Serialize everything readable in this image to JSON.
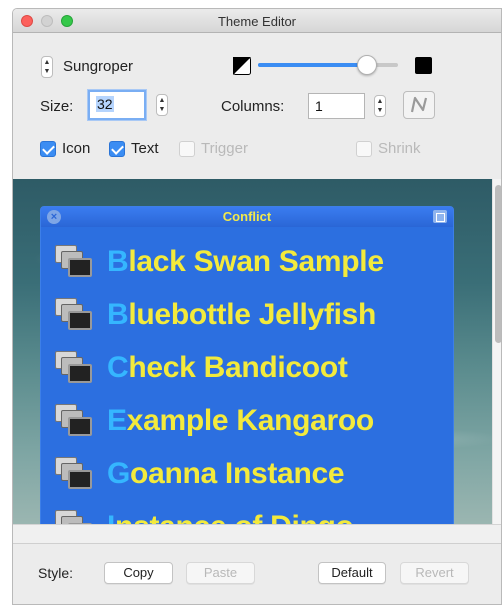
{
  "window": {
    "title": "Theme Editor"
  },
  "controls": {
    "theme_name": "Sungroper",
    "size_label": "Size:",
    "size_value": "32",
    "columns_label": "Columns:",
    "columns_value": "1",
    "opacity_level": 0.78,
    "checkboxes": [
      {
        "label": "Icon",
        "checked": true,
        "enabled": true
      },
      {
        "label": "Text",
        "checked": true,
        "enabled": true
      },
      {
        "label": "Trigger",
        "checked": false,
        "enabled": false
      },
      {
        "label": "Shrink",
        "checked": false,
        "enabled": false
      }
    ]
  },
  "preview": {
    "panel_title": "Conflict",
    "panel_color": "#2c6fe0",
    "text_color": "#f3ea3c",
    "initial_color": "#35b6ff",
    "items": [
      {
        "first": "B",
        "rest": "lack Swan Sample"
      },
      {
        "first": "B",
        "rest": "luebottle Jellyfish"
      },
      {
        "first": "C",
        "rest": "heck Bandicoot"
      },
      {
        "first": "E",
        "rest": "xample Kangaroo"
      },
      {
        "first": "G",
        "rest": "oanna Instance"
      },
      {
        "first": "I",
        "rest": "nstance of Dingo"
      }
    ]
  },
  "footer": {
    "style_label": "Style:",
    "copy_label": "Copy",
    "paste_label": "Paste",
    "default_label": "Default",
    "revert_label": "Revert"
  }
}
